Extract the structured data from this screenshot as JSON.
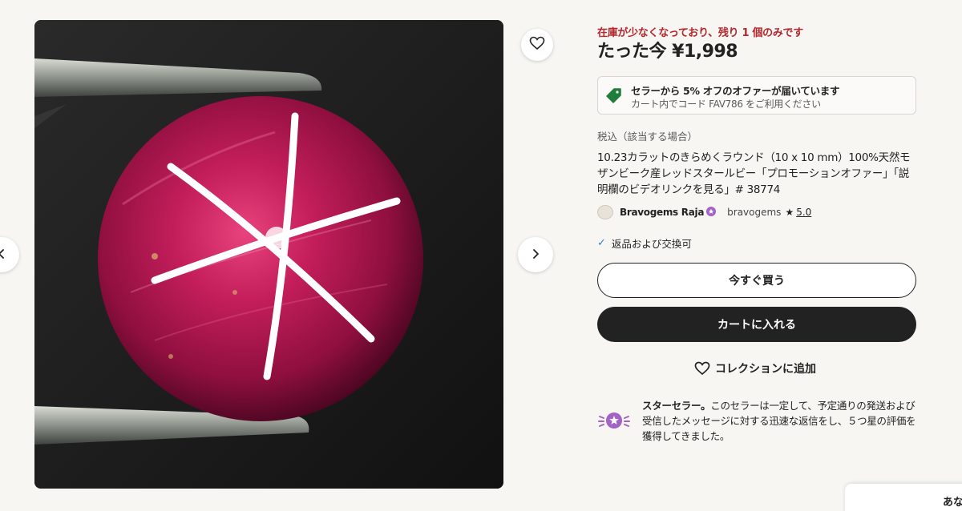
{
  "gallery": {
    "prev_icon": "chevron-left-icon",
    "next_icon": "chevron-right-icon",
    "favorite_icon": "heart-icon"
  },
  "listing": {
    "stock_alert": "在庫が少なくなっており、残り 1 個のみです",
    "price": "たった今 ¥1,998",
    "offer": {
      "title": "セラーから 5% オフのオファーが届いています",
      "subtitle": "カート内でコード FAV786 をご利用ください",
      "icon": "tag-icon",
      "icon_color": "#1e7d3a"
    },
    "tax_note": "税込（該当する場合）",
    "title": "10.23カラットのきらめくラウンド（10 x 10 mm）100%天然モザンビーク産レッドスタールビー「プロモーションオファー」「説明欄のビデオリンクを見る」# 38774",
    "shop": {
      "name": "Bravogems Raja",
      "handle": "bravogems",
      "star": "★",
      "rating": "5.0",
      "badge_color": "#a262c6"
    },
    "returns": {
      "check": "✓",
      "label": "返品および交換可"
    }
  },
  "actions": {
    "buy_now": "今すぐ買う",
    "add_to_cart": "カートに入れる",
    "add_to_collection": "コレクションに追加"
  },
  "star_seller": {
    "heading": "スターセラー。",
    "body": "このセラーは一定して、予定通りの発送および受信したメッセージに対する迅速な返信をし、５つ星の評価を獲得してきました。",
    "icon": "star-seller-badge-icon"
  },
  "chat": {
    "label": "あな"
  },
  "colors": {
    "accent_dark": "#222222",
    "alert_red": "#b3262c",
    "background": "#f7f6f3"
  }
}
